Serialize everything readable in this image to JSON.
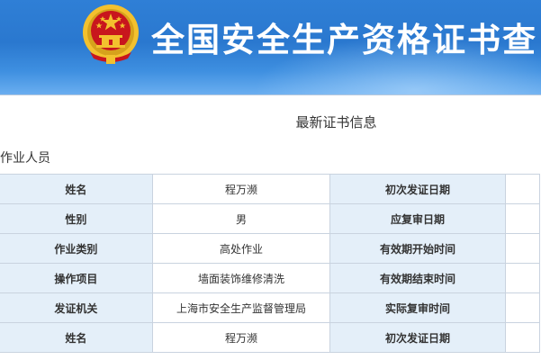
{
  "header": {
    "title": "全国安全生产资格证书查",
    "emblem_icon": "national-emblem-icon",
    "colors": {
      "banner": "#2a78cf",
      "emblem_red": "#c8161d",
      "emblem_gold": "#f3c12e"
    }
  },
  "section_title": "最新证书信息",
  "category_label": "作业人员",
  "table": {
    "rows": [
      {
        "label1": "姓名",
        "value1": "程万濒",
        "label2": "初次发证日期",
        "value2": ""
      },
      {
        "label1": "性别",
        "value1": "男",
        "label2": "应复审日期",
        "value2": ""
      },
      {
        "label1": "作业类别",
        "value1": "高处作业",
        "label2": "有效期开始时间",
        "value2": ""
      },
      {
        "label1": "操作项目",
        "value1": "墙面装饰维修清洗",
        "label2": "有效期结束时间",
        "value2": ""
      },
      {
        "label1": "发证机关",
        "value1": "上海市安全生产监督管理局",
        "label2": "实际复审时间",
        "value2": ""
      },
      {
        "label1": "姓名",
        "value1": "程万濒",
        "label2": "初次发证日期",
        "value2": ""
      }
    ]
  }
}
